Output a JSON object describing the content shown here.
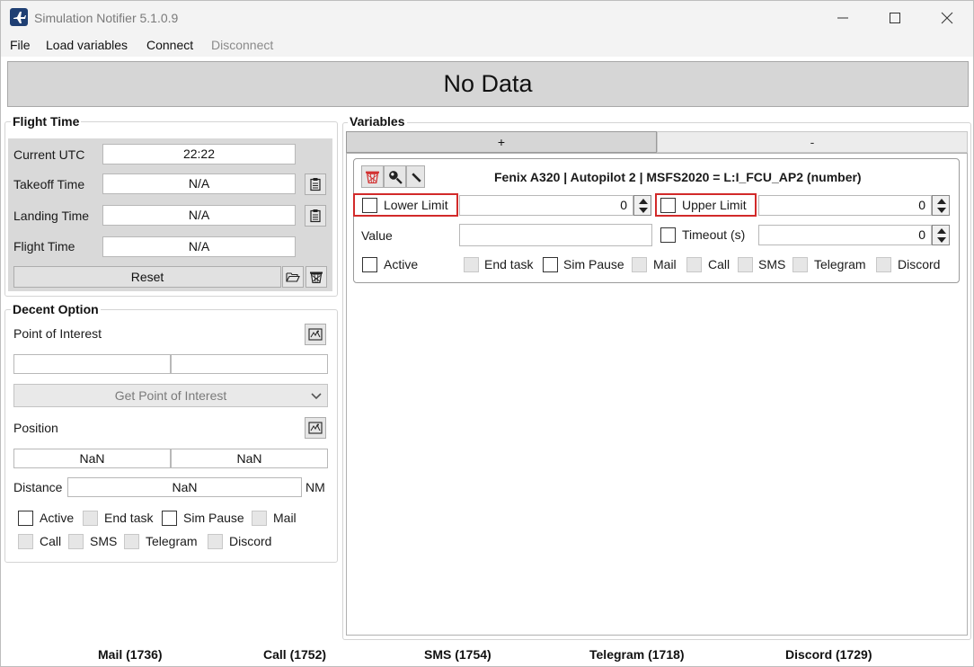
{
  "window": {
    "title": "Simulation Notifier 5.1.0.9",
    "icons": {
      "app": "airplane-icon",
      "minimize": "minimize-icon",
      "maximize": "maximize-icon",
      "close": "close-icon"
    }
  },
  "menu": {
    "file": "File",
    "load": "Load variables",
    "connect": "Connect",
    "disconnect": "Disconnect"
  },
  "banner": {
    "text": "No Data"
  },
  "flight_time": {
    "title": "Flight Time",
    "current_utc_label": "Current UTC",
    "current_utc_value": "22:22",
    "takeoff_label": "Takeoff Time",
    "takeoff_value": "N/A",
    "landing_label": "Landing Time",
    "landing_value": "N/A",
    "flight_label": "Flight Time",
    "flight_value": "N/A",
    "reset_label": "Reset"
  },
  "decent": {
    "title": "Decent Option",
    "poi_label": "Point of Interest",
    "poi_value1": "",
    "poi_value2": "",
    "get_poi_label": "Get Point of Interest",
    "position_label": "Position",
    "pos_value1": "NaN",
    "pos_value2": "NaN",
    "distance_label": "Distance",
    "distance_value": "NaN",
    "distance_unit": "NM",
    "checks": {
      "active": "Active",
      "end_task": "End task",
      "sim_pause": "Sim Pause",
      "mail": "Mail",
      "call": "Call",
      "sms": "SMS",
      "telegram": "Telegram",
      "discord": "Discord"
    }
  },
  "variables": {
    "title": "Variables",
    "add_label": "+",
    "remove_label": "-",
    "card": {
      "header": "Fenix A320 | Autopilot 2 | MSFS2020 = L:I_FCU_AP2 (number)",
      "lower_limit_label": "Lower Limit",
      "lower_limit_value": "0",
      "upper_limit_label": "Upper Limit",
      "upper_limit_value": "0",
      "value_label": "Value",
      "value_value": "",
      "timeout_label": "Timeout (s)",
      "timeout_value": "0",
      "checks": {
        "active": "Active",
        "end_task": "End task",
        "sim_pause": "Sim Pause",
        "mail": "Mail",
        "call": "Call",
        "sms": "SMS",
        "telegram": "Telegram",
        "discord": "Discord"
      }
    }
  },
  "status": {
    "mail": "Mail (1736)",
    "call": "Call (1752)",
    "sms": "SMS (1754)",
    "telegram": "Telegram (1718)",
    "discord": "Discord (1729)"
  },
  "colors": {
    "highlight": "#d22a2a",
    "banner_bg": "#d6d6d6",
    "panel_gray": "#d9d9d9",
    "app_icon": "#1f3f73"
  }
}
